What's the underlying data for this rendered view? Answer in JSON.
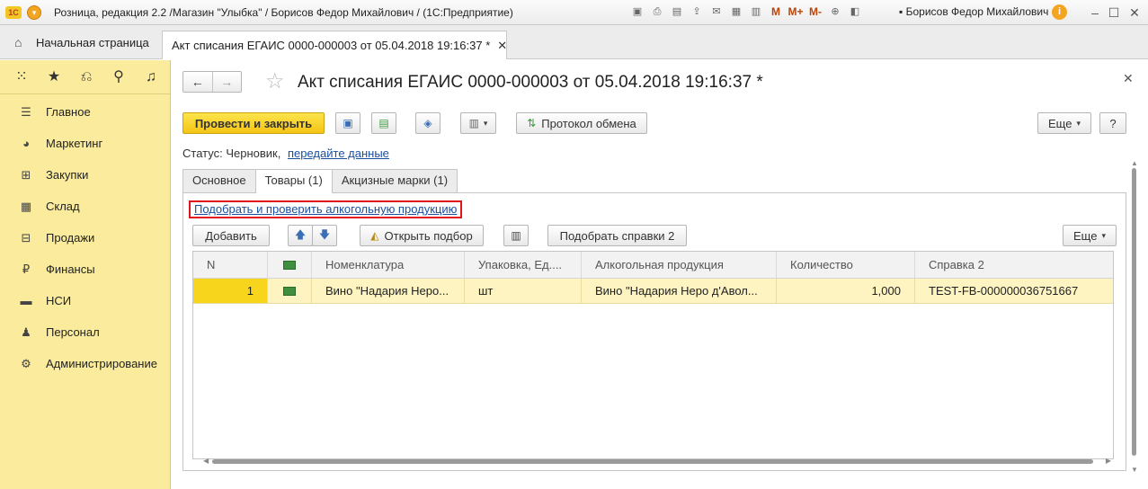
{
  "window": {
    "logo": "1С",
    "title": "Розница, редакция 2.2 /Магазин \"Улыбка\" / Борисов Федор Михайлович / (1С:Предприятие)",
    "user": "Борисов Федор Михайлович",
    "m_labels": [
      "M",
      "M+",
      "M-"
    ]
  },
  "tabs_bar": {
    "home": "Начальная страница",
    "document_tab": "Акт списания ЕГАИС 0000-000003 от 05.04.2018 19:16:37 *"
  },
  "sidebar": {
    "items": [
      {
        "label": "Главное",
        "icon": "menu-icon"
      },
      {
        "label": "Маркетинг",
        "icon": "pie-chart-icon"
      },
      {
        "label": "Закупки",
        "icon": "cart-icon"
      },
      {
        "label": "Склад",
        "icon": "warehouse-icon"
      },
      {
        "label": "Продажи",
        "icon": "basket-icon"
      },
      {
        "label": "Финансы",
        "icon": "ruble-icon"
      },
      {
        "label": "НСИ",
        "icon": "book-icon"
      },
      {
        "label": "Персонал",
        "icon": "person-icon"
      },
      {
        "label": "Администрирование",
        "icon": "gear-icon"
      }
    ]
  },
  "document": {
    "title": "Акт списания ЕГАИС 0000-000003 от 05.04.2018 19:16:37 *",
    "toolbar": {
      "post_close": "Провести и закрыть",
      "exchange_log": "Протокол обмена",
      "more": "Еще",
      "help": "?"
    },
    "status_label": "Статус:",
    "status_value": "Черновик,",
    "status_link": "передайте данные",
    "tabs": [
      "Основное",
      "Товары (1)",
      "Акцизные марки (1)"
    ],
    "active_tab": "Товары (1)",
    "goods": {
      "pick_link": "Подобрать и проверить алкогольную продукцию",
      "add": "Добавить",
      "open_picker": "Открыть подбор",
      "pick_certificates": "Подобрать справки 2",
      "more": "Еще",
      "columns": [
        "N",
        "",
        "Номенклатура",
        "Упаковка, Ед....",
        "Алкогольная продукция",
        "Количество",
        "Справка 2"
      ],
      "rows": [
        {
          "n": "1",
          "item": "Вино \"Надария Неро...",
          "pack": "шт",
          "alcohol": "Вино \"Надария Неро д'Авол...",
          "qty": "1,000",
          "cert": "TEST-FB-000000036751667"
        }
      ]
    }
  }
}
